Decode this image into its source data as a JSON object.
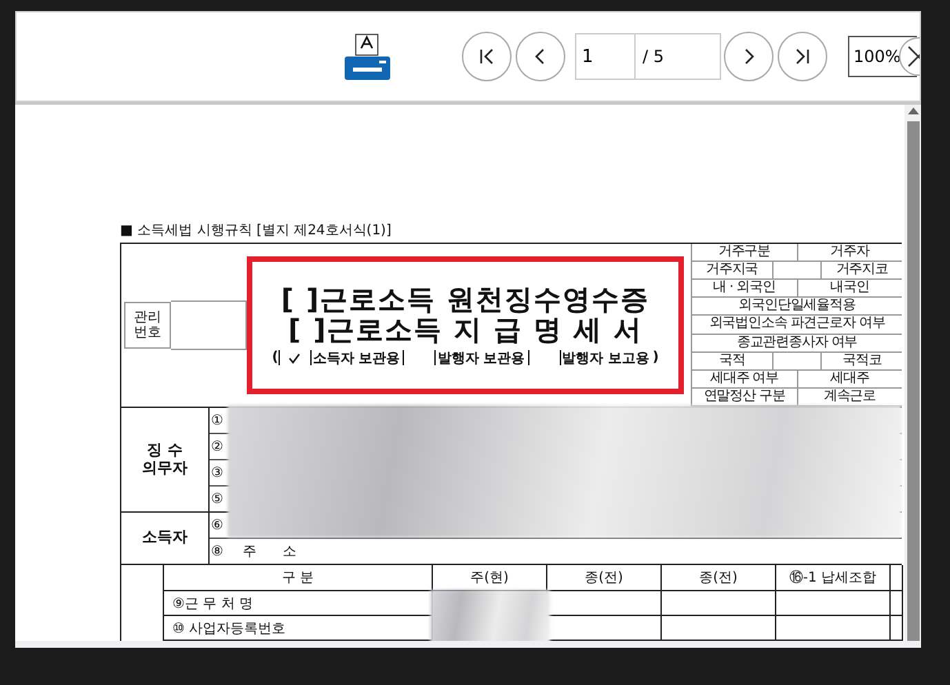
{
  "toolbar": {
    "page": "1",
    "page_total": "/ 5",
    "zoom": "100%"
  },
  "form": {
    "caption": "■ 소득세법 시행규칙 [별지 제24호서식(1)]",
    "management_label": "관리 번호",
    "title_lines": [
      "[  ]근로소득 원천징수영수증",
      "[  ]근로소득 지 급 명 세 서"
    ],
    "copies_open": "(",
    "copies_close": ")",
    "copies": [
      {
        "label": "소득자 보관용",
        "checked": true
      },
      {
        "label": "발행자 보관용",
        "checked": false
      },
      {
        "label": "발행자 보고용",
        "checked": false
      }
    ],
    "info_rows": [
      {
        "kind": "pair",
        "cells": [
          "거주구분",
          "거주자"
        ]
      },
      {
        "kind": "triple",
        "cells": [
          "거주지국",
          "",
          "거주지코"
        ]
      },
      {
        "kind": "pair",
        "cells": [
          "내 · 외국인",
          "내국인"
        ]
      },
      {
        "kind": "full",
        "cells": [
          "외국인단일세율적용"
        ]
      },
      {
        "kind": "full",
        "cells": [
          "외국법인소속 파견근로자 여부"
        ]
      },
      {
        "kind": "full",
        "cells": [
          "종교관련종사자 여부"
        ]
      },
      {
        "kind": "triple",
        "cells": [
          "국적",
          "",
          "국적코"
        ]
      },
      {
        "kind": "pair",
        "cells": [
          "세대주 여부",
          "세대주"
        ]
      },
      {
        "kind": "pair",
        "cells": [
          "연말정산 구분",
          "계속근로"
        ]
      }
    ],
    "parties": [
      {
        "label": "징 수 의무자",
        "rows": [
          {
            "number": "①"
          },
          {
            "number": "②"
          },
          {
            "number": "③"
          },
          {
            "number": "⑤"
          }
        ]
      },
      {
        "label": "소득자",
        "rows": [
          {
            "number": "⑥"
          },
          {
            "number": "⑧",
            "text": "주      소"
          }
        ]
      }
    ],
    "table": {
      "columns": [
        "구 분",
        "주(현)",
        "종(전)",
        "종(전)",
        "⑯-1 납세조합"
      ],
      "rows": [
        "⑨근 무 처 명",
        "⑩ 사업자등록번호"
      ]
    }
  }
}
